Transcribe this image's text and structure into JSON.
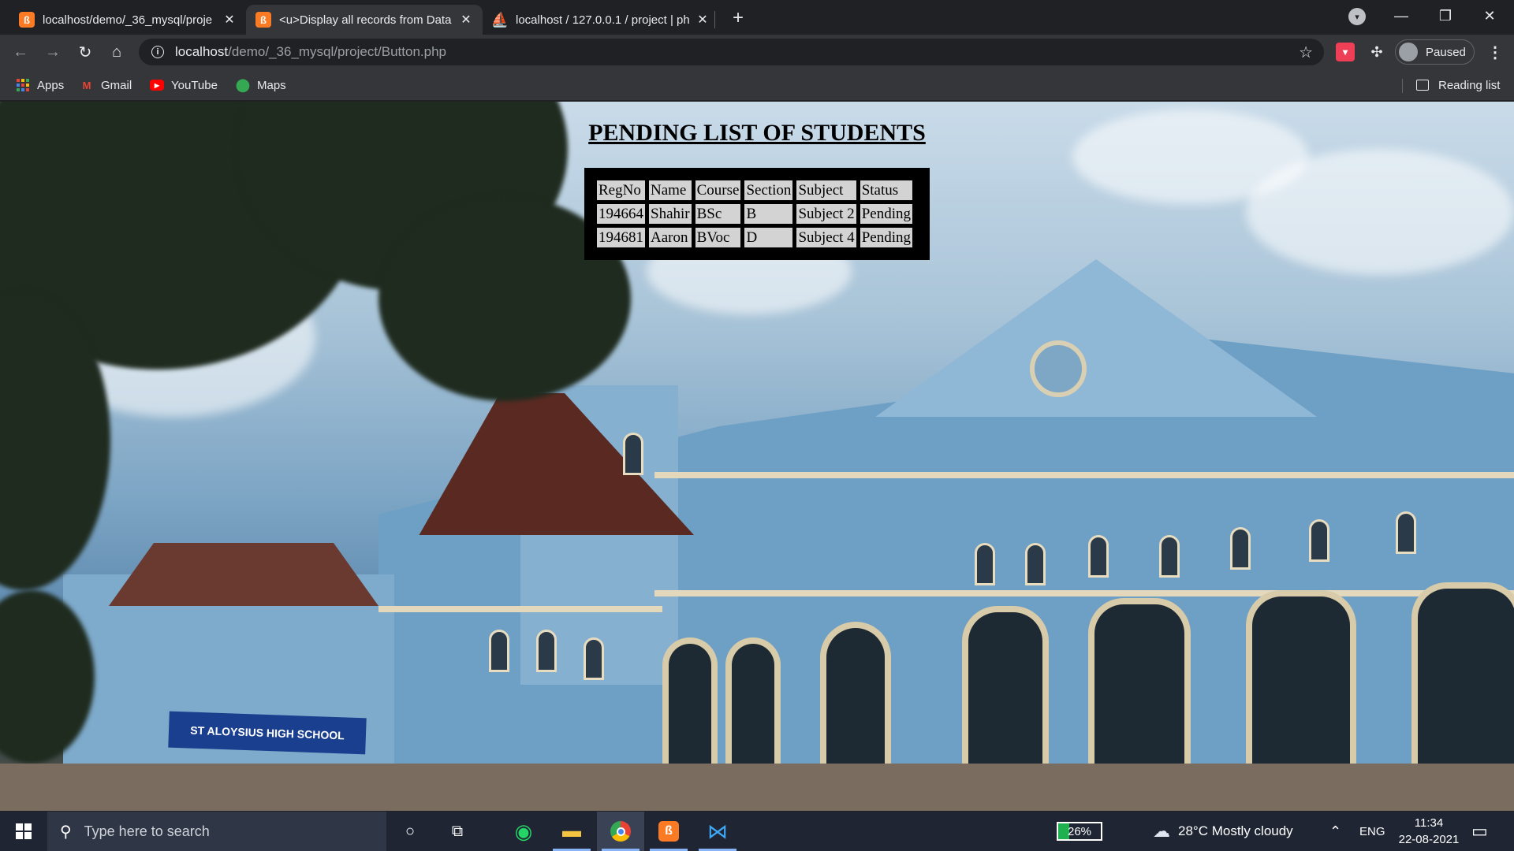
{
  "browser": {
    "tabs": [
      {
        "title": "localhost/demo/_36_mysql/proje",
        "active": false,
        "favicon": "xampp-icon"
      },
      {
        "title": "<u>Display all records from Data",
        "active": true,
        "favicon": "xampp-icon"
      },
      {
        "title": "localhost / 127.0.0.1 / project | ph",
        "active": false,
        "favicon": "phpmyadmin-icon"
      }
    ],
    "url_host": "localhost",
    "url_path": "/demo/_36_mysql/project/Button.php",
    "profile_status": "Paused",
    "bookmarks": [
      {
        "label": "Apps",
        "icon": "apps-grid-icon"
      },
      {
        "label": "Gmail",
        "icon": "gmail-icon"
      },
      {
        "label": "YouTube",
        "icon": "youtube-icon"
      },
      {
        "label": "Maps",
        "icon": "maps-icon"
      }
    ],
    "reading_list": "Reading list"
  },
  "page": {
    "heading": "PENDING LIST OF STUDENTS",
    "table": {
      "headers": [
        "RegNo",
        "Name",
        "Course",
        "Section",
        "Subject",
        "Status"
      ],
      "rows": [
        [
          "194664",
          "Shahir",
          "BSc",
          "B",
          "Subject 2",
          "Pending"
        ],
        [
          "194681",
          "Aaron",
          "BVoc",
          "D",
          "Subject 4",
          "Pending"
        ]
      ]
    },
    "background_sign": "ST ALOYSIUS HIGH SCHOOL"
  },
  "taskbar": {
    "search_placeholder": "Type here to search",
    "battery_percent": "26%",
    "weather": "28°C  Mostly cloudy",
    "language": "ENG",
    "time": "11:34",
    "date": "22-08-2021"
  }
}
